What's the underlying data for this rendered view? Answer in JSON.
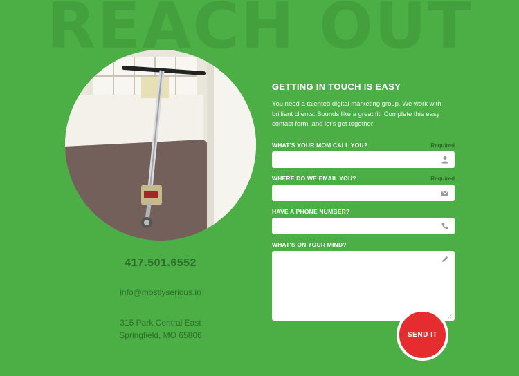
{
  "page": {
    "background_title": "REACH OUT"
  },
  "photo": {
    "subject": "scooter-photo",
    "scooter_brand": "Razor"
  },
  "contact": {
    "phone": "417.501.6552",
    "email": "info@mostlyserious.io",
    "address_line1": "315 Park Central East",
    "address_line2": "Springfield, MO 65806"
  },
  "form": {
    "heading": "GETTING IN TOUCH IS EASY",
    "intro": "You need a talented digital marketing group. We work with brilliant clients. Sounds like a great fit. Complete this easy contact form, and let's get together:",
    "fields": [
      {
        "label": "WHAT'S YOUR MOM CALL YOU?",
        "required": "Required",
        "value": "",
        "icon": "user-icon"
      },
      {
        "label": "WHERE DO WE EMAIL YOU?",
        "required": "Required",
        "value": "",
        "icon": "envelope-icon"
      },
      {
        "label": "HAVE A PHONE NUMBER?",
        "required": "",
        "value": "",
        "icon": "phone-icon"
      },
      {
        "label": "WHAT'S ON YOUR MIND?",
        "required": "",
        "value": "",
        "icon": "pencil-icon"
      }
    ],
    "submit_label": "SEND IT"
  },
  "colors": {
    "background": "#4caf45",
    "accent_dark_green": "#2f6b2b",
    "submit_red": "#e52d2f"
  }
}
